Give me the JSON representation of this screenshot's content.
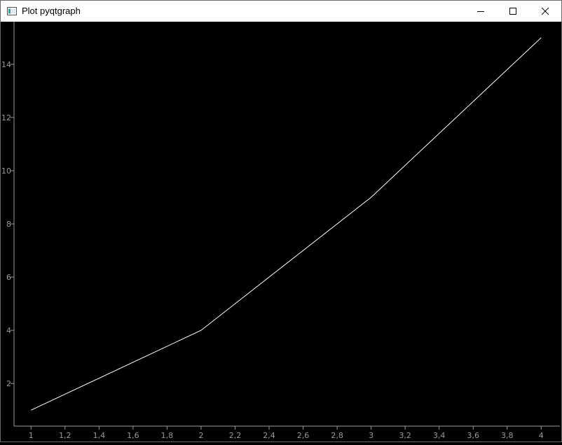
{
  "window": {
    "title": "Plot pyqtgraph",
    "buttons": {
      "minimize": "minimize-icon",
      "maximize": "maximize-icon",
      "close": "close-icon"
    }
  },
  "colors": {
    "background": "#000000",
    "line": "#ffffff",
    "axis": "#9a9a9a",
    "titlebar": "#ffffff"
  },
  "chart_data": {
    "type": "line",
    "title": "",
    "xlabel": "",
    "ylabel": "",
    "xlim": [
      0.9,
      4.11
    ],
    "ylim": [
      0.4,
      15.6
    ],
    "grid": false,
    "x_ticks": [
      1,
      1.2,
      1.4,
      1.6,
      1.8,
      2,
      2.2,
      2.4,
      2.6,
      2.8,
      3,
      3.2,
      3.4,
      3.6,
      3.8,
      4
    ],
    "x_tick_labels": [
      "1",
      "1,2",
      "1,4",
      "1,6",
      "1,8",
      "2",
      "2,2",
      "2,4",
      "2,6",
      "2,8",
      "3",
      "3,2",
      "3,4",
      "3,6",
      "3,8",
      "4"
    ],
    "y_ticks": [
      2,
      4,
      6,
      8,
      10,
      12,
      14
    ],
    "y_tick_labels": [
      "2",
      "4",
      "6",
      "8",
      "10",
      "12",
      "14"
    ],
    "series": [
      {
        "x": [
          1,
          2,
          3,
          4
        ],
        "y": [
          1,
          4,
          9,
          15
        ]
      }
    ]
  }
}
